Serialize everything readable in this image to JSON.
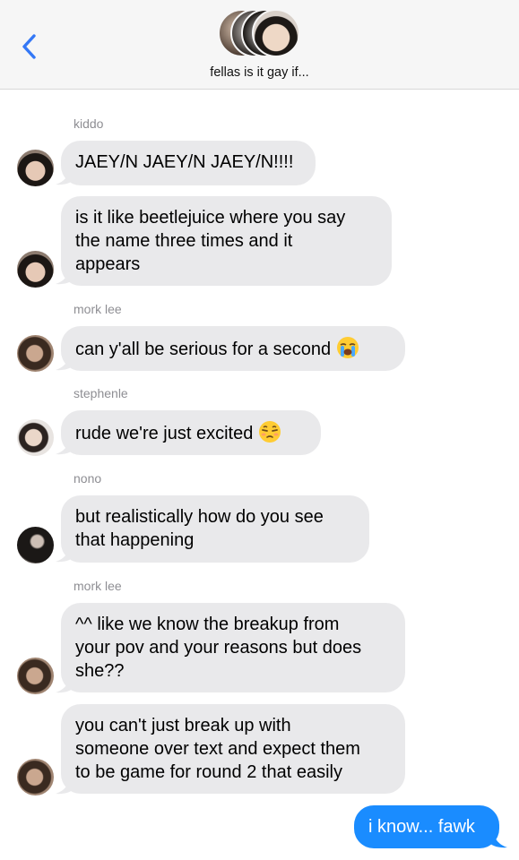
{
  "header": {
    "title": "fellas is it gay if...",
    "back_icon": "chevron-left-icon",
    "accent": "#3478f6"
  },
  "messages": [
    {
      "sender": "kiddo",
      "text": "JAEY/N JAEY/N JAEY/N!!!!"
    },
    {
      "text": "is it like beetlejuice where you say\nthe name three times and it\nappears"
    },
    {
      "sender": "mork lee",
      "text": "can y'all be serious for a second",
      "emoji": "loudly-crying-face"
    },
    {
      "sender": "stephenle",
      "text": "rude we're just excited",
      "emoji": "unamused-face"
    },
    {
      "sender": "nono",
      "text": "but realistically how do you see\nthat happening"
    },
    {
      "sender": "mork lee",
      "text": "^^ like we know the breakup from\nyour pov and your reasons but does\nshe??"
    },
    {
      "text": "you can't just break up with\nsomeone over text and expect them\nto be game for round 2 that easily"
    },
    {
      "text": "i know... fawk",
      "outgoing": true
    }
  ],
  "colors": {
    "incoming_bubble": "#e9e9eb",
    "outgoing_bubble": "#1a8cff",
    "sender_name": "#8e8e93"
  }
}
